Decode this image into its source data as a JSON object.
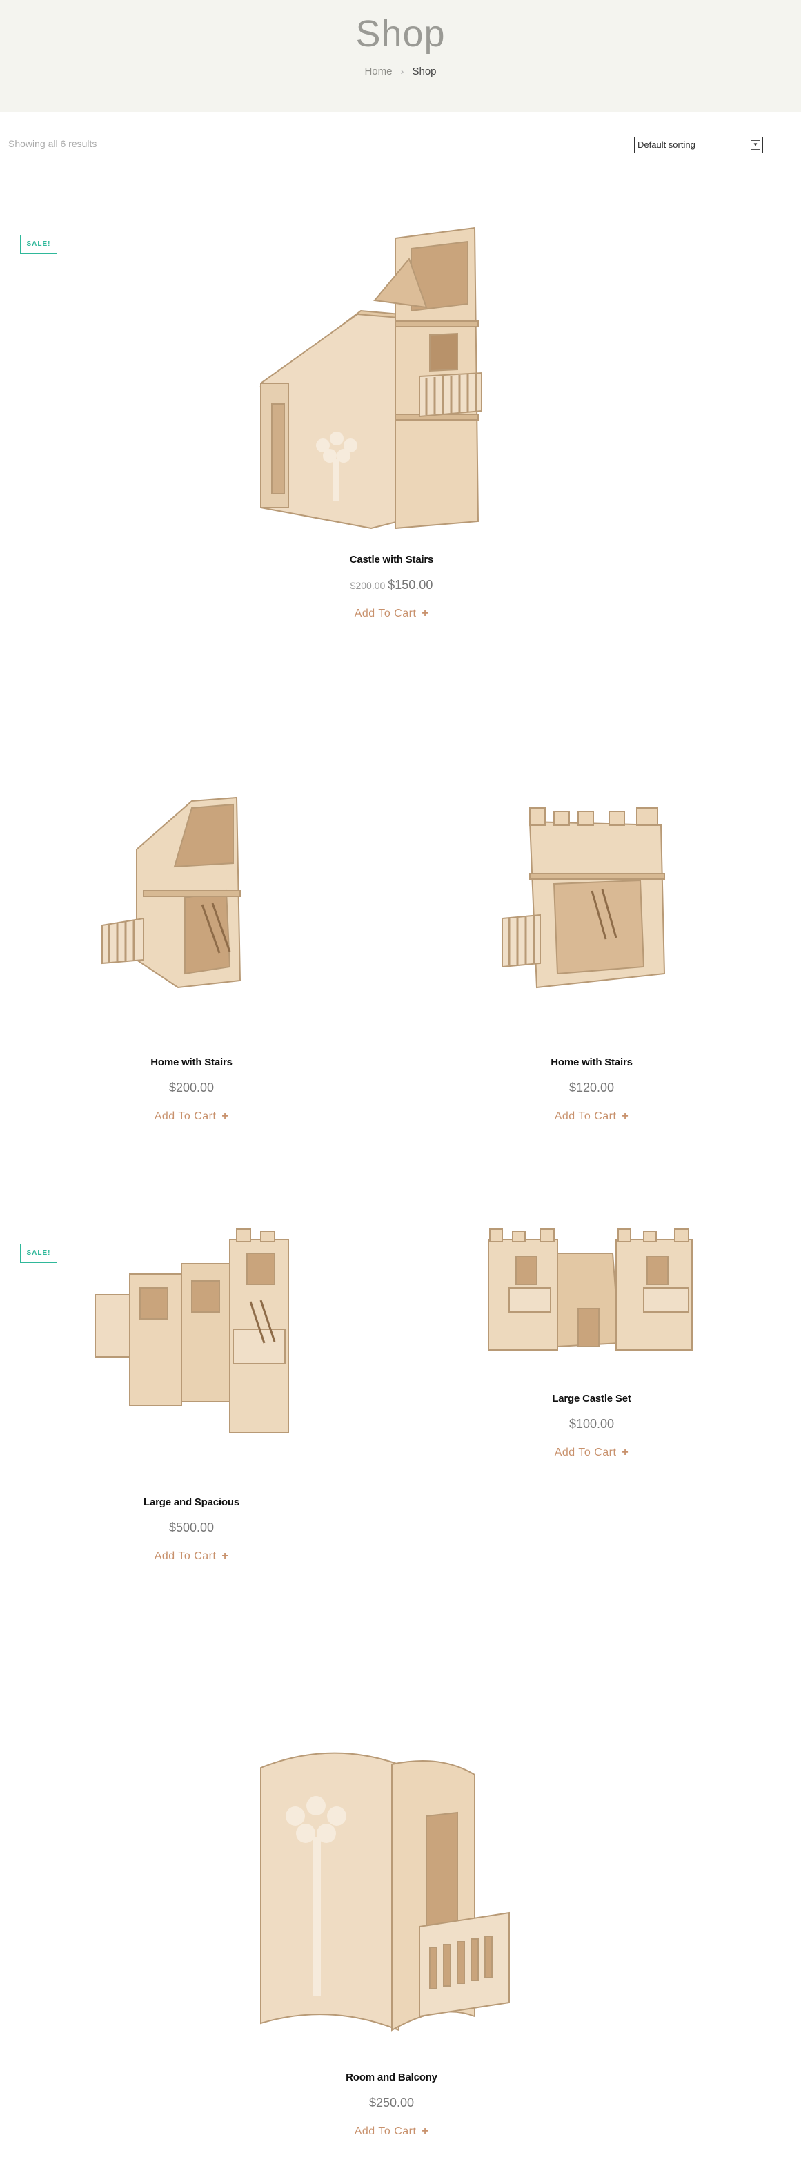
{
  "header": {
    "title": "Shop",
    "breadcrumb": {
      "home": "Home",
      "separator": "›",
      "current": "Shop"
    }
  },
  "toolbar": {
    "result_count": "Showing all 6 results",
    "sorting": {
      "selected": "Default sorting"
    }
  },
  "colors": {
    "header_bg": "#f4f4ef",
    "accent": "#c8916c",
    "sale": "#2fb89a",
    "wood": "#e8d2b6"
  },
  "products": [
    {
      "name": "Castle with Stairs",
      "old_price": "$200.00",
      "price": "$150.00",
      "cart": "Add To Cart",
      "plus": "+",
      "sale": "SALE!"
    },
    {
      "name": "Home with Stairs",
      "price": "$200.00",
      "cart": "Add To Cart",
      "plus": "+"
    },
    {
      "name": "Home with Stairs",
      "price": "$120.00",
      "cart": "Add To Cart",
      "plus": "+"
    },
    {
      "name": "Large and Spacious",
      "price": "$500.00",
      "cart": "Add To Cart",
      "plus": "+",
      "sale": "SALE!"
    },
    {
      "name": "Large Castle Set",
      "price": "$100.00",
      "cart": "Add To Cart",
      "plus": "+"
    },
    {
      "name": "Room and Balcony",
      "price": "$250.00",
      "cart": "Add To Cart",
      "plus": "+"
    }
  ]
}
